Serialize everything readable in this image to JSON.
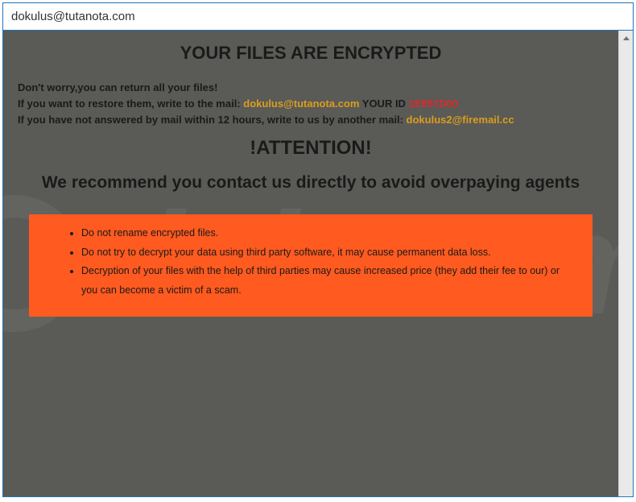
{
  "titlebar": {
    "title": "dokulus@tutanota.com"
  },
  "content": {
    "heading": "YOUR FILES ARE ENCRYPTED",
    "line1": "Don't worry,you can return all your files!",
    "line2": {
      "prefix": "If you want to restore them, write to the mail:  ",
      "email": "dokulus@tutanota.com",
      "id_label": "  YOUR ID ",
      "id_value": "1E857D00"
    },
    "line3": {
      "prefix": "If you have not answered by mail within 12 hours, write to us by another mail: ",
      "email": "dokulus2@firemail.cc"
    },
    "attention": "!ATTENTION!",
    "recommend": "We recommend you contact us directly to avoid overpaying agents",
    "warnings": [
      "Do not rename encrypted files.",
      "Do not try to decrypt your data using third party software, it may cause permanent data loss.",
      "Decryption of your files with the help of third parties may cause increased price (they add their fee to our) or you can become a victim of a scam."
    ]
  }
}
